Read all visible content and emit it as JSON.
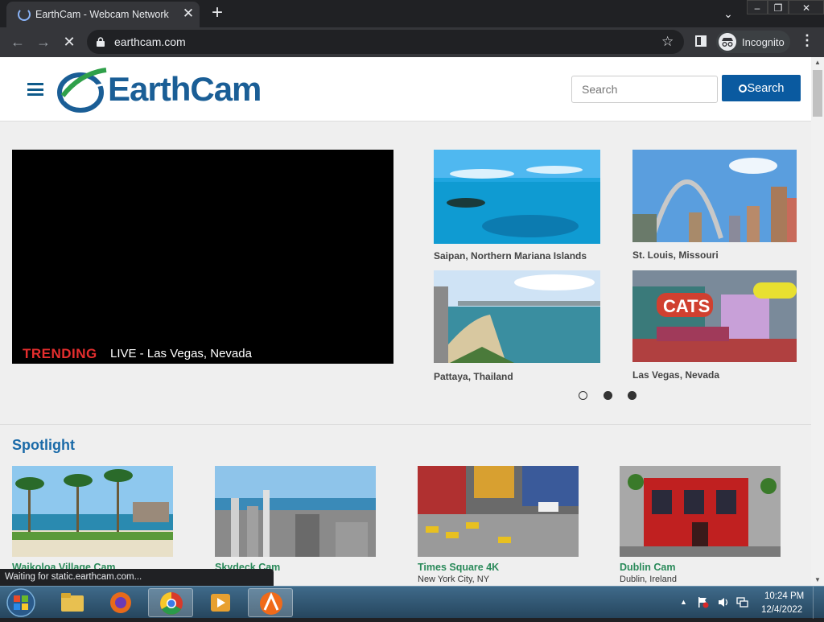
{
  "browser": {
    "tab_title": "EarthCam - Webcam Network",
    "url": "earthcam.com",
    "incognito_label": "Incognito"
  },
  "header": {
    "logo_text": "EarthCam",
    "search_placeholder": "Search",
    "search_button_label": "Search"
  },
  "trending": {
    "label": "TRENDING",
    "text": "LIVE - Las Vegas, Nevada"
  },
  "featured": [
    {
      "label": "Saipan, Northern Mariana Islands"
    },
    {
      "label": "St. Louis, Missouri"
    },
    {
      "label": "Pattaya, Thailand"
    },
    {
      "label": "Las Vegas, Nevada"
    }
  ],
  "spotlight": {
    "title": "Spotlight",
    "cards": [
      {
        "name": "Waikoloa Village Cam",
        "location": ""
      },
      {
        "name": "Skydeck Cam",
        "location": ""
      },
      {
        "name": "Times Square 4K",
        "location": "New York City, NY"
      },
      {
        "name": "Dublin Cam",
        "location": "Dublin, Ireland"
      }
    ]
  },
  "status": {
    "text": "Waiting for static.earthcam.com..."
  },
  "taskbar": {
    "time": "10:24 PM",
    "date": "12/4/2022"
  },
  "colors": {
    "brand_blue": "#1a5e96",
    "trending_red": "#e62e2e",
    "spotlight_green": "#2a8a5a"
  }
}
